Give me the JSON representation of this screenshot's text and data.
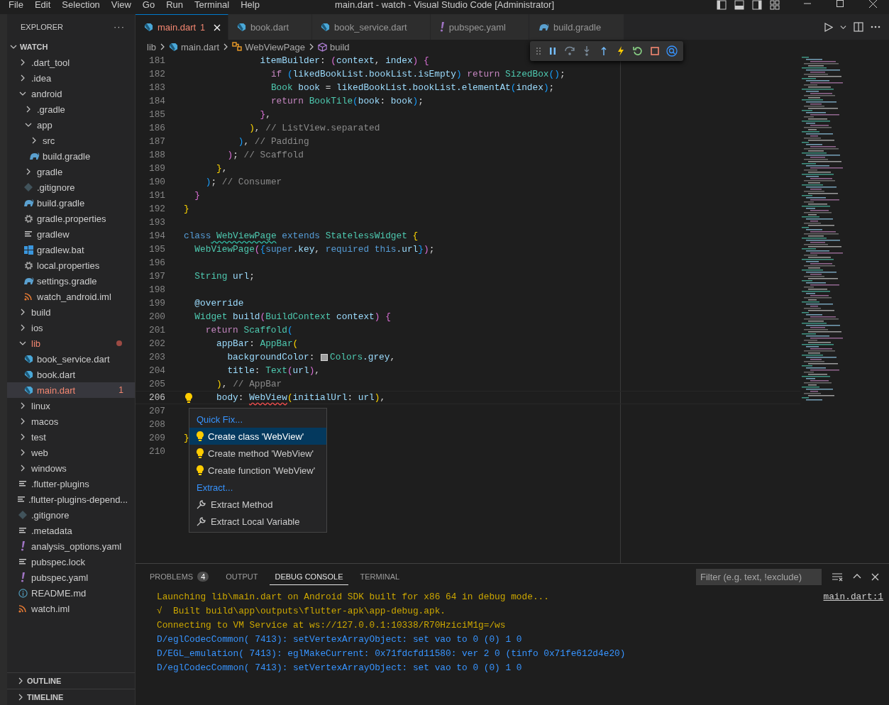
{
  "menu": [
    "File",
    "Edit",
    "Selection",
    "View",
    "Go",
    "Run",
    "Terminal",
    "Help"
  ],
  "window": {
    "title": "main.dart - watch - Visual Studio Code [Administrator]"
  },
  "sidebar": {
    "title": "EXPLORER",
    "more": "···",
    "section": {
      "label": "WATCH",
      "expanded": true
    },
    "tree": [
      {
        "label": ".dart_tool",
        "kind": "folder",
        "expanded": false,
        "error": false,
        "selected": false
      },
      {
        "label": ".idea",
        "kind": "folder",
        "expanded": false,
        "error": false,
        "selected": false
      },
      {
        "label": "android",
        "kind": "folder",
        "expanded": true,
        "error": false,
        "selected": false,
        "children": [
          {
            "label": ".gradle",
            "kind": "folder",
            "expanded": false,
            "error": false,
            "selected": false
          },
          {
            "label": "app",
            "kind": "folder",
            "expanded": true,
            "error": false,
            "selected": false,
            "children": [
              {
                "label": "src",
                "kind": "folder",
                "expanded": false,
                "error": false,
                "selected": false
              },
              {
                "label": "build.gradle",
                "kind": "gradle",
                "error": false,
                "selected": false
              }
            ]
          },
          {
            "label": "gradle",
            "kind": "folder",
            "expanded": false,
            "error": false,
            "selected": false
          },
          {
            "label": ".gitignore",
            "kind": "git",
            "error": false,
            "selected": false
          },
          {
            "label": "build.gradle",
            "kind": "gradle",
            "error": false,
            "selected": false
          },
          {
            "label": "gradle.properties",
            "kind": "gear",
            "error": false,
            "selected": false
          },
          {
            "label": "gradlew",
            "kind": "lines",
            "error": false,
            "selected": false
          },
          {
            "label": "gradlew.bat",
            "kind": "windows",
            "error": false,
            "selected": false
          },
          {
            "label": "local.properties",
            "kind": "gear",
            "error": false,
            "selected": false
          },
          {
            "label": "settings.gradle",
            "kind": "gradle",
            "error": false,
            "selected": false
          },
          {
            "label": "watch_android.iml",
            "kind": "xml",
            "error": false,
            "selected": false
          }
        ]
      },
      {
        "label": "build",
        "kind": "folder",
        "expanded": false,
        "error": false,
        "selected": false
      },
      {
        "label": "ios",
        "kind": "folder",
        "expanded": false,
        "error": false,
        "selected": false
      },
      {
        "label": "lib",
        "kind": "folder",
        "expanded": true,
        "error": true,
        "selected": false,
        "children": [
          {
            "label": "book_service.dart",
            "kind": "dart",
            "error": false,
            "selected": false
          },
          {
            "label": "book.dart",
            "kind": "dart",
            "error": false,
            "selected": false
          },
          {
            "label": "main.dart",
            "kind": "dart",
            "error": true,
            "selected": true,
            "badge": "1"
          }
        ]
      },
      {
        "label": "linux",
        "kind": "folder",
        "expanded": false,
        "error": false,
        "selected": false
      },
      {
        "label": "macos",
        "kind": "folder",
        "expanded": false,
        "error": false,
        "selected": false
      },
      {
        "label": "test",
        "kind": "folder",
        "expanded": false,
        "error": false,
        "selected": false
      },
      {
        "label": "web",
        "kind": "folder",
        "expanded": false,
        "error": false,
        "selected": false
      },
      {
        "label": "windows",
        "kind": "folder",
        "expanded": false,
        "error": false,
        "selected": false
      },
      {
        "label": ".flutter-plugins",
        "kind": "lines",
        "error": false,
        "selected": false
      },
      {
        "label": ".flutter-plugins-depend...",
        "kind": "lines",
        "error": false,
        "selected": false
      },
      {
        "label": ".gitignore",
        "kind": "git",
        "error": false,
        "selected": false
      },
      {
        "label": ".metadata",
        "kind": "lines",
        "error": false,
        "selected": false
      },
      {
        "label": "analysis_options.yaml",
        "kind": "yaml",
        "error": false,
        "selected": false
      },
      {
        "label": "pubspec.lock",
        "kind": "lines",
        "error": false,
        "selected": false
      },
      {
        "label": "pubspec.yaml",
        "kind": "yaml",
        "error": false,
        "selected": false
      },
      {
        "label": "README.md",
        "kind": "info",
        "error": false,
        "selected": false
      },
      {
        "label": "watch.iml",
        "kind": "xml",
        "error": false,
        "selected": false
      }
    ],
    "bottom_sections": [
      {
        "label": "OUTLINE",
        "expanded": false
      },
      {
        "label": "TIMELINE",
        "expanded": false
      }
    ]
  },
  "tabs": [
    {
      "label": "main.dart",
      "kind": "dart",
      "selected": true,
      "error": true,
      "badge": "1"
    },
    {
      "label": "book.dart",
      "kind": "dart",
      "selected": false,
      "error": false
    },
    {
      "label": "book_service.dart",
      "kind": "dart",
      "selected": false,
      "error": false
    },
    {
      "label": "pubspec.yaml",
      "kind": "yaml",
      "selected": false,
      "error": false
    },
    {
      "label": "build.gradle",
      "kind": "gradle",
      "selected": false,
      "error": false
    }
  ],
  "breadcrumb": [
    {
      "label": "lib",
      "kind": "folder"
    },
    {
      "label": "main.dart",
      "kind": "dart"
    },
    {
      "label": "WebViewPage",
      "kind": "class"
    },
    {
      "label": "build",
      "kind": "method"
    }
  ],
  "editor": {
    "lines": [
      {
        "number": "181",
        "current": false,
        "tokens": [
          {
            "text": "              itemBuilder",
            "kind": "v"
          },
          {
            "text": ": ",
            "kind": "p"
          },
          {
            "text": "(",
            "kind": "b2"
          },
          {
            "text": "context",
            "kind": "v"
          },
          {
            "text": ", ",
            "kind": "p"
          },
          {
            "text": "index",
            "kind": "v"
          },
          {
            "text": ")",
            "kind": "b2"
          },
          {
            "text": " {",
            "kind": "b2"
          }
        ]
      },
      {
        "number": "182",
        "current": false,
        "tokens": [
          {
            "text": "                if",
            "kind": "k"
          },
          {
            "text": " (",
            "kind": "b3"
          },
          {
            "text": "likedBookList.bookList.isEmpty",
            "kind": "v"
          },
          {
            "text": ")",
            "kind": "b3"
          },
          {
            "text": " return",
            "kind": "k"
          },
          {
            "text": " SizedBox",
            "kind": "t"
          },
          {
            "text": "()",
            "kind": "b3"
          },
          {
            "text": ";",
            "kind": "p"
          }
        ]
      },
      {
        "number": "183",
        "current": false,
        "tokens": [
          {
            "text": "                Book",
            "kind": "t"
          },
          {
            "text": " book",
            "kind": "v"
          },
          {
            "text": " = ",
            "kind": "p"
          },
          {
            "text": "likedBookList.bookList.elementAt",
            "kind": "v"
          },
          {
            "text": "(",
            "kind": "b3"
          },
          {
            "text": "index",
            "kind": "v"
          },
          {
            "text": ")",
            "kind": "b3"
          },
          {
            "text": ";",
            "kind": "p"
          }
        ]
      },
      {
        "number": "184",
        "current": false,
        "tokens": [
          {
            "text": "                return",
            "kind": "k"
          },
          {
            "text": " BookTile",
            "kind": "t"
          },
          {
            "text": "(",
            "kind": "b3"
          },
          {
            "text": "book",
            "kind": "v"
          },
          {
            "text": ": ",
            "kind": "p"
          },
          {
            "text": "book",
            "kind": "v"
          },
          {
            "text": ")",
            "kind": "b3"
          },
          {
            "text": ";",
            "kind": "p"
          }
        ]
      },
      {
        "number": "185",
        "current": false,
        "tokens": [
          {
            "text": "              }",
            "kind": "b2"
          },
          {
            "text": ",",
            "kind": "p"
          }
        ]
      },
      {
        "number": "186",
        "current": false,
        "tokens": [
          {
            "text": "            )",
            "kind": "b1"
          },
          {
            "text": ", ",
            "kind": "p"
          },
          {
            "text": "// ListView.separated",
            "kind": "c"
          }
        ]
      },
      {
        "number": "187",
        "current": false,
        "tokens": [
          {
            "text": "          )",
            "kind": "b3"
          },
          {
            "text": ", ",
            "kind": "p"
          },
          {
            "text": "// Padding",
            "kind": "c"
          }
        ]
      },
      {
        "number": "188",
        "current": false,
        "tokens": [
          {
            "text": "        )",
            "kind": "b2"
          },
          {
            "text": "; ",
            "kind": "p"
          },
          {
            "text": "// Scaffold",
            "kind": "c"
          }
        ]
      },
      {
        "number": "189",
        "current": false,
        "tokens": [
          {
            "text": "      }",
            "kind": "b1"
          },
          {
            "text": ",",
            "kind": "p"
          }
        ]
      },
      {
        "number": "190",
        "current": false,
        "tokens": [
          {
            "text": "    )",
            "kind": "b3"
          },
          {
            "text": "; ",
            "kind": "p"
          },
          {
            "text": "// Consumer",
            "kind": "c"
          }
        ]
      },
      {
        "number": "191",
        "current": false,
        "tokens": [
          {
            "text": "  }",
            "kind": "b2"
          }
        ]
      },
      {
        "number": "192",
        "current": false,
        "tokens": [
          {
            "text": "}",
            "kind": "b1"
          }
        ]
      },
      {
        "number": "193",
        "current": false
      },
      {
        "number": "194",
        "current": false,
        "tokens": [
          {
            "text": "class",
            "kind": "d"
          },
          {
            "text": " WebViewPage",
            "kind": "hint"
          },
          {
            "text": " extends",
            "kind": "d"
          },
          {
            "text": " StatelessWidget",
            "kind": "t"
          },
          {
            "text": " {",
            "kind": "b1"
          }
        ]
      },
      {
        "number": "195",
        "current": false,
        "tokens": [
          {
            "text": "  WebViewPage",
            "kind": "t"
          },
          {
            "text": "(",
            "kind": "b2"
          },
          {
            "text": "{",
            "kind": "b3"
          },
          {
            "text": "super",
            "kind": "d"
          },
          {
            "text": ".key",
            "kind": "v"
          },
          {
            "text": ", ",
            "kind": "p"
          },
          {
            "text": "required",
            "kind": "d"
          },
          {
            "text": " this",
            "kind": "d"
          },
          {
            "text": ".url",
            "kind": "v"
          },
          {
            "text": "}",
            "kind": "b3"
          },
          {
            "text": ")",
            "kind": "b2"
          },
          {
            "text": ";",
            "kind": "p"
          }
        ]
      },
      {
        "number": "196",
        "current": false
      },
      {
        "number": "197",
        "current": false,
        "tokens": [
          {
            "text": "  String",
            "kind": "t"
          },
          {
            "text": " url",
            "kind": "v"
          },
          {
            "text": ";",
            "kind": "p"
          }
        ]
      },
      {
        "number": "198",
        "current": false
      },
      {
        "number": "199",
        "current": false,
        "tokens": [
          {
            "text": "  @override",
            "kind": "v"
          }
        ]
      },
      {
        "number": "200",
        "current": false,
        "tokens": [
          {
            "text": "  Widget",
            "kind": "t"
          },
          {
            "text": " build",
            "kind": "v"
          },
          {
            "text": "(",
            "kind": "b2"
          },
          {
            "text": "BuildContext",
            "kind": "t"
          },
          {
            "text": " context",
            "kind": "v"
          },
          {
            "text": ")",
            "kind": "b2"
          },
          {
            "text": " {",
            "kind": "b2"
          }
        ]
      },
      {
        "number": "201",
        "current": false,
        "tokens": [
          {
            "text": "    return",
            "kind": "k"
          },
          {
            "text": " Scaffold",
            "kind": "t"
          },
          {
            "text": "(",
            "kind": "b3"
          }
        ]
      },
      {
        "number": "202",
        "current": false,
        "tokens": [
          {
            "text": "      appBar",
            "kind": "v"
          },
          {
            "text": ": ",
            "kind": "p"
          },
          {
            "text": "AppBar",
            "kind": "t"
          },
          {
            "text": "(",
            "kind": "b1"
          }
        ]
      },
      {
        "number": "203",
        "current": false,
        "tokens": [
          {
            "text": "        backgroundColor",
            "kind": "v"
          },
          {
            "text": ": ",
            "kind": "p"
          },
          {
            "kind": "swatch",
            "color": "#9e9e9e"
          },
          {
            "text": "Colors",
            "kind": "t"
          },
          {
            "text": ".grey",
            "kind": "v"
          },
          {
            "text": ",",
            "kind": "p"
          }
        ]
      },
      {
        "number": "204",
        "current": false,
        "tokens": [
          {
            "text": "        title",
            "kind": "v"
          },
          {
            "text": ": ",
            "kind": "p"
          },
          {
            "text": "Text",
            "kind": "t"
          },
          {
            "text": "(",
            "kind": "b2"
          },
          {
            "text": "url",
            "kind": "v"
          },
          {
            "text": ")",
            "kind": "b2"
          },
          {
            "text": ",",
            "kind": "p"
          }
        ]
      },
      {
        "number": "205",
        "current": false,
        "tokens": [
          {
            "text": "      )",
            "kind": "b1"
          },
          {
            "text": ", ",
            "kind": "p"
          },
          {
            "text": "// AppBar",
            "kind": "c"
          }
        ]
      },
      {
        "number": "206",
        "current": true,
        "tokens": [
          {
            "text": "      body",
            "kind": "v"
          },
          {
            "text": ": ",
            "kind": "p"
          },
          {
            "text": "WebView",
            "kind": "error"
          },
          {
            "text": "(",
            "kind": "b1"
          },
          {
            "text": "initialUrl",
            "kind": "v"
          },
          {
            "text": ": ",
            "kind": "p"
          },
          {
            "text": "url",
            "kind": "v"
          },
          {
            "text": ")",
            "kind": "b1"
          },
          {
            "text": ",",
            "kind": "p"
          }
        ]
      },
      {
        "number": "207",
        "current": false
      },
      {
        "number": "208",
        "current": false
      },
      {
        "number": "209",
        "current": false,
        "tokens": [
          {
            "text": "}",
            "kind": "b1"
          }
        ]
      },
      {
        "number": "210",
        "current": false
      }
    ]
  },
  "quick_fix_menu": [
    {
      "kind": "header",
      "label": "Quick Fix..."
    },
    {
      "kind": "fix",
      "label": "Create class 'WebView'",
      "selected": true
    },
    {
      "kind": "fix",
      "label": "Create method 'WebView'",
      "selected": false
    },
    {
      "kind": "fix",
      "label": "Create function 'WebView'",
      "selected": false
    },
    {
      "kind": "header",
      "label": "Extract..."
    },
    {
      "kind": "refactor",
      "label": "Extract Method",
      "selected": false
    },
    {
      "kind": "refactor",
      "label": "Extract Local Variable",
      "selected": false
    }
  ],
  "panel": {
    "tabs": [
      {
        "label": "PROBLEMS",
        "badge": "4",
        "selected": false
      },
      {
        "label": "OUTPUT",
        "selected": false
      },
      {
        "label": "DEBUG CONSOLE",
        "selected": true
      },
      {
        "label": "TERMINAL",
        "selected": false
      }
    ],
    "filter": {
      "placeholder": "Filter (e.g. text, !exclude)"
    },
    "lines": [
      {
        "kind": "info",
        "text": "Launching lib\\main.dart on Android SDK built for x86 64 in debug mode...",
        "link": "main.dart:1"
      },
      {
        "kind": "info",
        "text": "√  Built build\\app\\outputs\\flutter-apk\\app-debug.apk."
      },
      {
        "kind": "info",
        "text": "Connecting to VM Service at ws://127.0.0.1:10338/R70HziciM1g=/ws"
      },
      {
        "kind": "log",
        "text": "D/eglCodecCommon( 7413): setVertexArrayObject: set vao to 0 (0) 1 0"
      },
      {
        "kind": "log",
        "text": "D/EGL_emulation( 7413): eglMakeCurrent: 0x71fdcfd11580: ver 2 0 (tinfo 0x71fe612d4e20)"
      },
      {
        "kind": "log",
        "text": "D/eglCodecCommon( 7413): setVertexArrayObject: set vao to 0 (0) 1 0"
      }
    ]
  }
}
